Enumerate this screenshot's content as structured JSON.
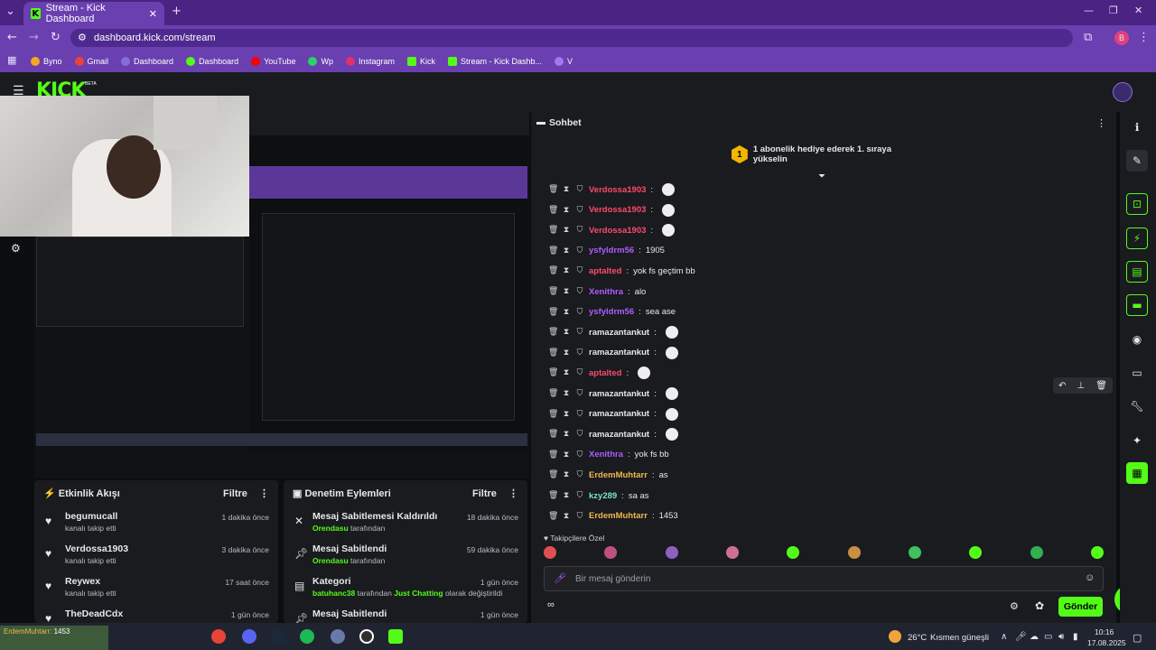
{
  "browser": {
    "tab_title": "Stream - Kick Dashboard",
    "url": "dashboard.kick.com/stream",
    "profile_initial": "B",
    "bookmarks": [
      "Byno",
      "Gmail",
      "Dashboard",
      "Dashboard",
      "YouTube",
      "Wp",
      "Instagram",
      "Kick",
      "Stream - Kick Dashb...",
      "V"
    ]
  },
  "header": {
    "logo": "KICK",
    "beta": "BETA"
  },
  "activity": {
    "title": "Etkinlik Akışı",
    "filter": "Filtre",
    "items": [
      {
        "name": "begumucall",
        "sub": "kanalı takip etti",
        "time": "1 dakika önce"
      },
      {
        "name": "Verdossa1903",
        "sub": "kanalı takip etti",
        "time": "3 dakika önce"
      },
      {
        "name": "Reywex",
        "sub": "kanalı takip etti",
        "time": "17 saat önce"
      },
      {
        "name": "TheDeadCdx",
        "sub": "",
        "time": "1 gün önce"
      }
    ]
  },
  "mod": {
    "title": "Denetim Eylemleri",
    "filter": "Filtre",
    "items": [
      {
        "name": "Mesaj Sabitlemesi Kaldırıldı",
        "user": "Orendasu",
        "rest": " tarafından",
        "time": "18 dakika önce"
      },
      {
        "name": "Mesaj Sabitlendi",
        "user": "Orendasu",
        "rest": " tarafından",
        "time": "59 dakika önce"
      },
      {
        "name": "Kategori",
        "user": "batuhanc38",
        "rest": " tarafından ",
        "cat": "Just Chatting",
        "rest2": " olarak değiştirildi",
        "time": "1 gün önce"
      },
      {
        "name": "Mesaj Sabitlendi",
        "user": "",
        "rest": "",
        "time": "1 gün önce"
      }
    ]
  },
  "chat": {
    "title": "Sohbet",
    "goal_badge": "1",
    "goal_text": "1 abonelik hediye ederek 1. sıraya yükselin",
    "messages": [
      {
        "user": "Verdossa1903",
        "color": "#ff4a6b",
        "text": ""
      },
      {
        "user": "Verdossa1903",
        "color": "#ff4a6b",
        "text": ""
      },
      {
        "user": "Verdossa1903",
        "color": "#ff4a6b",
        "text": ""
      },
      {
        "user": "ysfyldrm56",
        "color": "#b05cff",
        "text": "1905"
      },
      {
        "user": "aptalted",
        "color": "#ff4a6b",
        "text": "yok fs geçtim bb"
      },
      {
        "user": "Xenithra",
        "color": "#b05cff",
        "text": "alo"
      },
      {
        "user": "ysfyldrm56",
        "color": "#b05cff",
        "text": "sea ase"
      },
      {
        "user": "ramazantankut",
        "color": "#e6e8ea",
        "text": ""
      },
      {
        "user": "ramazantankut",
        "color": "#e6e8ea",
        "text": ""
      },
      {
        "user": "aptalted",
        "color": "#ff4a6b",
        "text": ""
      },
      {
        "user": "ramazantankut",
        "color": "#e6e8ea",
        "text": ""
      },
      {
        "user": "ramazantankut",
        "color": "#e6e8ea",
        "text": ""
      },
      {
        "user": "ramazantankut",
        "color": "#e6e8ea",
        "text": ""
      },
      {
        "user": "Xenithra",
        "color": "#b05cff",
        "text": "yok fs bb"
      },
      {
        "user": "ErdemMuhtarr",
        "color": "#f2b84b",
        "text": "as"
      },
      {
        "user": "kzy289",
        "color": "#7ee0d0",
        "text": "sa as"
      },
      {
        "user": "ErdemMuhtarr",
        "color": "#f2b84b",
        "text": "1453"
      }
    ],
    "emote_label": "Takipçilere Özel",
    "placeholder": "Bir mesaj gönderin",
    "send": "Gönder"
  },
  "taskbar": {
    "weather": "26°C",
    "weather_text": "Kısmen güneşli",
    "time": "10:16",
    "date": "17.08.2025",
    "overlay_user": "ErdemMuhtarr",
    "overlay_msg": "1453"
  },
  "colors": {
    "accent": "#53fc18",
    "purple": "#6a3fb0"
  }
}
